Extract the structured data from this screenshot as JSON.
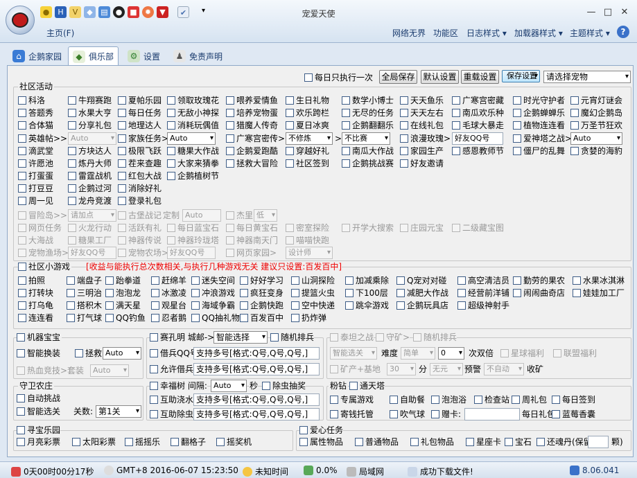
{
  "app": {
    "title": "宠爱天使",
    "home": "主页(F)",
    "menus": [
      "网络无界",
      "功能区",
      "日志样式 ▾",
      "加载器样式 ▾",
      "主题样式 ▾"
    ]
  },
  "tabs": [
    "企鹅家园",
    "俱乐部",
    "设置",
    "免责声明"
  ],
  "topbar": {
    "daily_once": "每日只执行一次",
    "btn_save_all": "全局保存",
    "btn_default": "默认设置",
    "btn_reload": "重载设置",
    "btn_save": "保存设置",
    "pet_select": "请选择宠物"
  },
  "club": {
    "title": "社区活动",
    "rows": [
      [
        "科洛",
        "牛翔赛跑",
        "夏帕乐园",
        "领取玫瑰花",
        "喂养爱情鱼",
        "生日礼物",
        "数学小博士",
        "天天鱼乐",
        "广寒宫密藏",
        "时光守护者",
        "元宵灯谜会"
      ],
      [
        "答题秀",
        "水果大亨",
        "每日任务",
        "无敌小神探",
        "培养宠物蛋",
        "欢乐跨栏",
        "无尽的任务",
        "天天左右",
        "南瓜欢乐种",
        "企鹅蝉蝉乐",
        "魔幻企鹅岛"
      ],
      [
        "合体猫",
        "分享礼包",
        "地理达人",
        "消耗玩偶值",
        "猎魔人传奇",
        "夏日冰爽",
        "企鹅翻翻乐",
        "在线礼包",
        "毛球大暴走",
        "植物连连看",
        "万圣节狂欢"
      ]
    ],
    "row4": {
      "yingxiong": "英雄帖>>",
      "auto1": "Auto",
      "jiazu": "家族任务>",
      "auto2": "Auto",
      "guanghan": "广寒宫密传>",
      "buxiulian": "不修炼",
      "bibisai": "不比赛",
      "langman": "浪漫玫瑰>",
      "qq": "好友QQ号",
      "aishen": "爱神塔之战>",
      "auto3": "Auto"
    },
    "row5": [
      "滴武堂",
      "方块达人",
      "极限飞跃",
      "糖果大作战",
      "企鹅爱跑酷",
      "穿越好礼",
      "南瓜大作战",
      "家园生产",
      "感恩教师节",
      "僵尸的乱舞",
      "贪婪的海豹"
    ],
    "row6": [
      "许愿池",
      "炼丹大师",
      "茬来查趣",
      "大家来猜拳",
      "拯救大冒险",
      "社区签到",
      "企鹅挑战赛",
      "好友邀请"
    ],
    "row7": [
      "打蛋蛋",
      "雷霆战机",
      "红包大战",
      "企鹅植树节"
    ],
    "row8": [
      "打豆豆",
      "企鹅过河",
      "消除好礼"
    ],
    "row9": [
      "周一见",
      "龙舟竞渡",
      "登录礼包"
    ],
    "disabled": {
      "maoxian": "冒险岛>>",
      "add": "请加点",
      "gubao": "古堡战记",
      "dingzhi": "定制",
      "auto4": "Auto",
      "jieli": "杰里",
      "di": "低",
      "r2": [
        "网页任务",
        "火龙行动",
        "活跃有礼",
        "每日蓝宝石",
        "每日黄宝石",
        "密室探险",
        "开学大搜索",
        "庄园元宝",
        "二级藏宝图"
      ],
      "r3": [
        "大海战",
        "糖果工厂",
        "神器传说",
        "神器玲珑塔",
        "神器南天门",
        "喵喵快跑"
      ],
      "yuchang": "宠物渔场>",
      "qq2": "好友QQ号",
      "nongchang": "宠物农场>",
      "qq3": "好友QQ号",
      "wangye": "网页家园>",
      "sheji": "设计师"
    }
  },
  "mini": {
    "title": "社区小游戏",
    "warn": "[收益与能执行总次数相关,与执行几种游戏无关 建议只设置:百发百中]",
    "rows": [
      [
        "拍照",
        "端盘子",
        "跆拳道",
        "赶绵羊",
        "迷失空间",
        "好好学习",
        "山洞探险",
        "加减乘除",
        "Q宠对对碰",
        "高空清洁员",
        "勤劳的果农",
        "水果冰淇淋"
      ],
      [
        "打转块",
        "三明治",
        "泡泡龙",
        "冰激凌",
        "冲浪游戏",
        "疯狂变身",
        "提篮火虫",
        "下100层",
        "减肥大作战",
        "经营前洋铺",
        "闹闹曲奇店",
        "娃娃加工厂"
      ],
      [
        "打乌龟",
        "搭积木",
        "满天星",
        "观星台",
        "海域争霸",
        "企鹅快跑",
        "空中快递",
        "跳伞游戏",
        "企鹅玩具店",
        "超级神射手"
      ],
      [
        "连连看",
        "打气球",
        "QQ钓鱼",
        "忍者鹅",
        "QQ抽礼物",
        "百发百中",
        "扔炸弹"
      ]
    ]
  },
  "machine": {
    "title": "机器宝宝",
    "smart": "智能换装",
    "nini": "拯救",
    "auto": "Auto",
    "hot": "热血竞技>套装",
    "auto2": "Auto"
  },
  "saikong": {
    "title": "赛孔明 城邮->",
    "select": "智能选择",
    "random": "随机排兵",
    "jie": "借兵QQ号",
    "allow": "允许借兵",
    "multi": "支持多号[格式:Q号,Q号,Q号,]"
  },
  "taitan": {
    "title": "泰坦之战",
    "shou": "守矿>",
    "random": "随机排兵",
    "smart": "智能选关",
    "diff": "难度",
    "simple": "简单",
    "zero": "0",
    "times": "次双倍",
    "xingyu": "星球福利",
    "lianmeng": "联盟福利",
    "kuang": "矿产+基地",
    "n30": "30",
    "fen": "分",
    "wuyuan": "无元",
    "yujing": "预警",
    "auto": "不自动",
    "shou2": "收矿"
  },
  "guard": {
    "title": "守卫农庄",
    "auto": "自动挑战",
    "smart": "智能选关",
    "level": "关数:",
    "lv": "第1关"
  },
  "tree": {
    "title": "幸福树 间隔:",
    "auto": "Auto",
    "sec": "秒",
    "chuchong": "除虫抽奖",
    "water": "互助浇水",
    "bug": "互助除虫",
    "multi": "支持多号[格式:Q号,Q号,Q号,]"
  },
  "fen": {
    "title": "粉钻",
    "tong": "通天塔",
    "items": [
      "专属游戏",
      "自助餐",
      "泡泡浴",
      "检查站",
      "周礼包",
      "每日签到"
    ],
    "items2": [
      "寄钱托管",
      "吹气球",
      "赠卡:",
      "",
      "每日礼包",
      "蓝莓香囊"
    ]
  },
  "treasure": {
    "title": "寻宝乐园",
    "items": [
      "月亮彩票",
      "太阳彩票",
      "摇摇乐",
      "翻格子",
      "摇奖机"
    ]
  },
  "love": {
    "title": "爱心任务",
    "items": [
      "属性物品",
      "普通物品",
      "礼包物品",
      "星座卡",
      "宝石",
      "还魂丹(保留"
    ],
    "unit": "颗)"
  },
  "status": {
    "time": "0天00时00分17秒",
    "gmt": "GMT+8 2016-06-07 15:23:50",
    "weather": "未知时间",
    "progress": "0.0%",
    "net": "局域网",
    "download": "成功下载文件!",
    "version": "8.06.041"
  }
}
